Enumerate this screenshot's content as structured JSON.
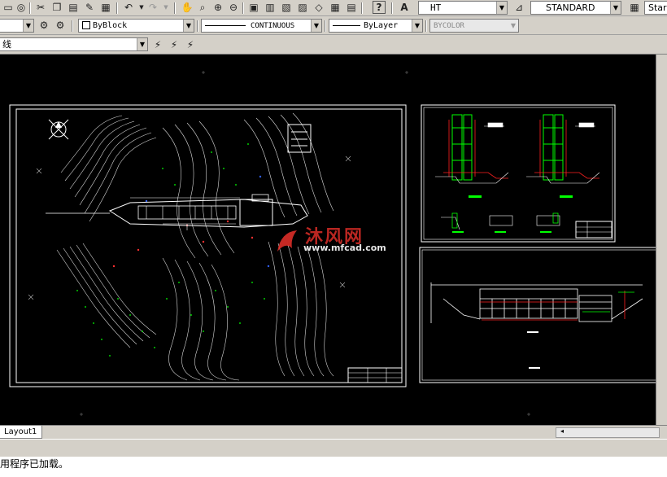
{
  "toolbar_top": {
    "text_style": "HT",
    "dim_style": "STANDARD",
    "table_style_partial": "Star"
  },
  "toolbar_props": {
    "color": "ByBlock",
    "linetype": "CONTINUOUS",
    "lineweight": "ByLayer",
    "plotstyle": "BYCOLOR"
  },
  "toolbar_layer": {
    "layer_name_partial": "线"
  },
  "watermark": {
    "cn": "沐风网",
    "url": "www.mfcad.com"
  },
  "tabs": {
    "layout1": "Layout1"
  },
  "command": {
    "line1": "用程序已加载。"
  },
  "colors": {
    "ui_gray": "#d4d0c8",
    "canvas": "#000000",
    "contour": "#ffffff",
    "green": "#00ff00",
    "red": "#ff0000",
    "watermark_red": "#e8302a",
    "watermark_blue": "#1e64c8"
  }
}
